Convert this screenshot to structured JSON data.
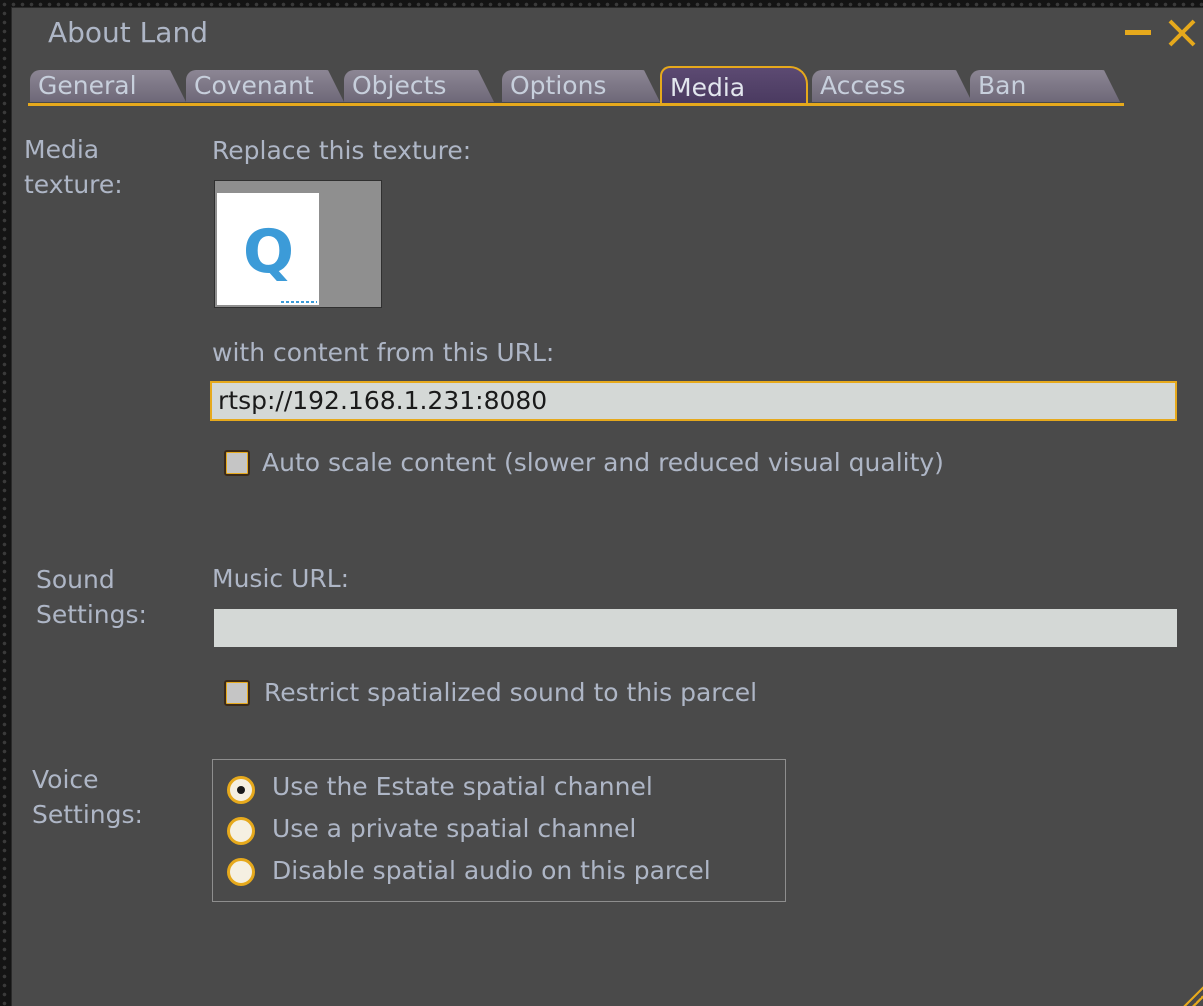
{
  "window": {
    "title": "About Land"
  },
  "tabs": [
    {
      "label": "General"
    },
    {
      "label": "Covenant"
    },
    {
      "label": "Objects"
    },
    {
      "label": "Options"
    },
    {
      "label": "Media",
      "active": true
    },
    {
      "label": "Access"
    },
    {
      "label": "Ban"
    }
  ],
  "media": {
    "section_label_line1": "Media",
    "section_label_line2": "texture:",
    "replace_label": "Replace this texture:",
    "url_label": "with content from this URL:",
    "url_value": "rtsp://192.168.1.231:8080",
    "auto_scale_label": "Auto scale content (slower and reduced visual quality)",
    "auto_scale_checked": false
  },
  "sound": {
    "section_label_line1": "Sound",
    "section_label_line2": "Settings:",
    "music_url_label": "Music URL:",
    "music_url_value": "",
    "restrict_label": "Restrict spatialized sound to this parcel",
    "restrict_checked": false
  },
  "voice": {
    "section_label_line1": "Voice",
    "section_label_line2": "Settings:",
    "options": [
      {
        "label": "Use the Estate spatial channel",
        "checked": true
      },
      {
        "label": "Use a private spatial channel",
        "checked": false
      },
      {
        "label": "Disable spatial audio on this parcel",
        "checked": false
      }
    ]
  },
  "colors": {
    "accent": "#e6a91c",
    "panel": "#4a4a4a",
    "text": "#aeb6c6",
    "active_tab": "#5c4a72"
  },
  "icons": {
    "texture_preview": "quicktime-logo-icon",
    "minimize": "minimize-icon",
    "close": "close-icon"
  }
}
